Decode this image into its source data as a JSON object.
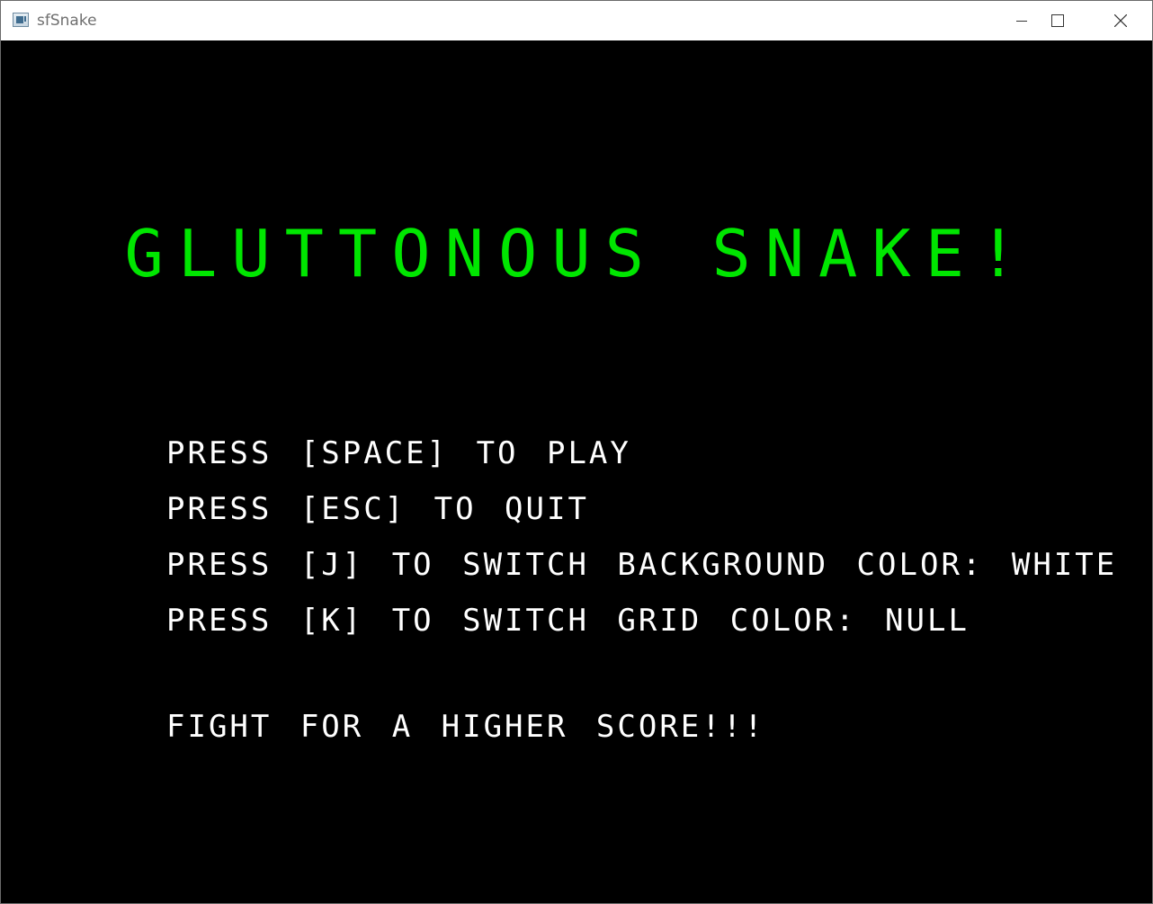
{
  "window": {
    "title": "sfSnake",
    "icon": "app-window-icon",
    "controls": [
      "minimize-icon",
      "maximize-icon",
      "close-icon"
    ]
  },
  "colors": {
    "background": "#000000",
    "title": "#00e600",
    "text": "#ffffff"
  },
  "menu": {
    "title": "GLUTTONOUS SNAKE!",
    "instructions": [
      "PRESS [SPACE] TO PLAY",
      "PRESS [ESC] TO QUIT",
      "PRESS [J] TO SWITCH BACKGROUND COLOR: WHITE",
      "PRESS [K] TO SWITCH GRID COLOR: NULL"
    ],
    "slogan": "FIGHT FOR A HIGHER SCORE!!!"
  }
}
